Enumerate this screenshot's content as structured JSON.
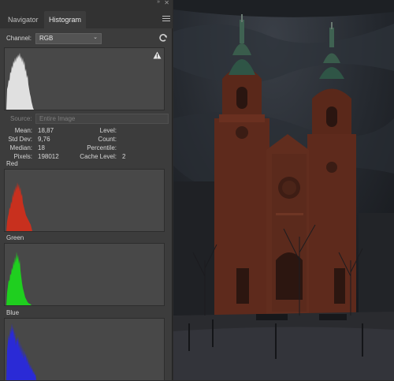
{
  "tabs": [
    "Navigator",
    "Histogram"
  ],
  "channel": {
    "label": "Channel:",
    "value": "RGB"
  },
  "source": {
    "label": "Source:",
    "value": "Entire Image"
  },
  "stats_left": [
    {
      "label": "Mean:",
      "value": "18,87"
    },
    {
      "label": "Std Dev:",
      "value": "9,76"
    },
    {
      "label": "Median:",
      "value": "18"
    },
    {
      "label": "Pixels:",
      "value": "198012"
    }
  ],
  "stats_right": [
    {
      "label": "Level:",
      "value": ""
    },
    {
      "label": "Count:",
      "value": ""
    },
    {
      "label": "Percentile:",
      "value": ""
    },
    {
      "label": "Cache Level:",
      "value": "2"
    }
  ],
  "channels": [
    {
      "name": "",
      "color": "#e0e0e0"
    },
    {
      "name": "Red",
      "color": "#c8301e"
    },
    {
      "name": "Green",
      "color": "#1fcf1f"
    },
    {
      "name": "Blue",
      "color": "#2a2ad6"
    }
  ],
  "icons": {
    "collapse": "double-arrow-icon",
    "close": "close-icon",
    "menu": "panel-menu-icon",
    "refresh": "refresh-icon",
    "warning": "warning-icon",
    "dropdown": "chevron-down-icon"
  },
  "colors": {
    "panel": "#3c3c3c",
    "histogram_bg": "#484848"
  }
}
